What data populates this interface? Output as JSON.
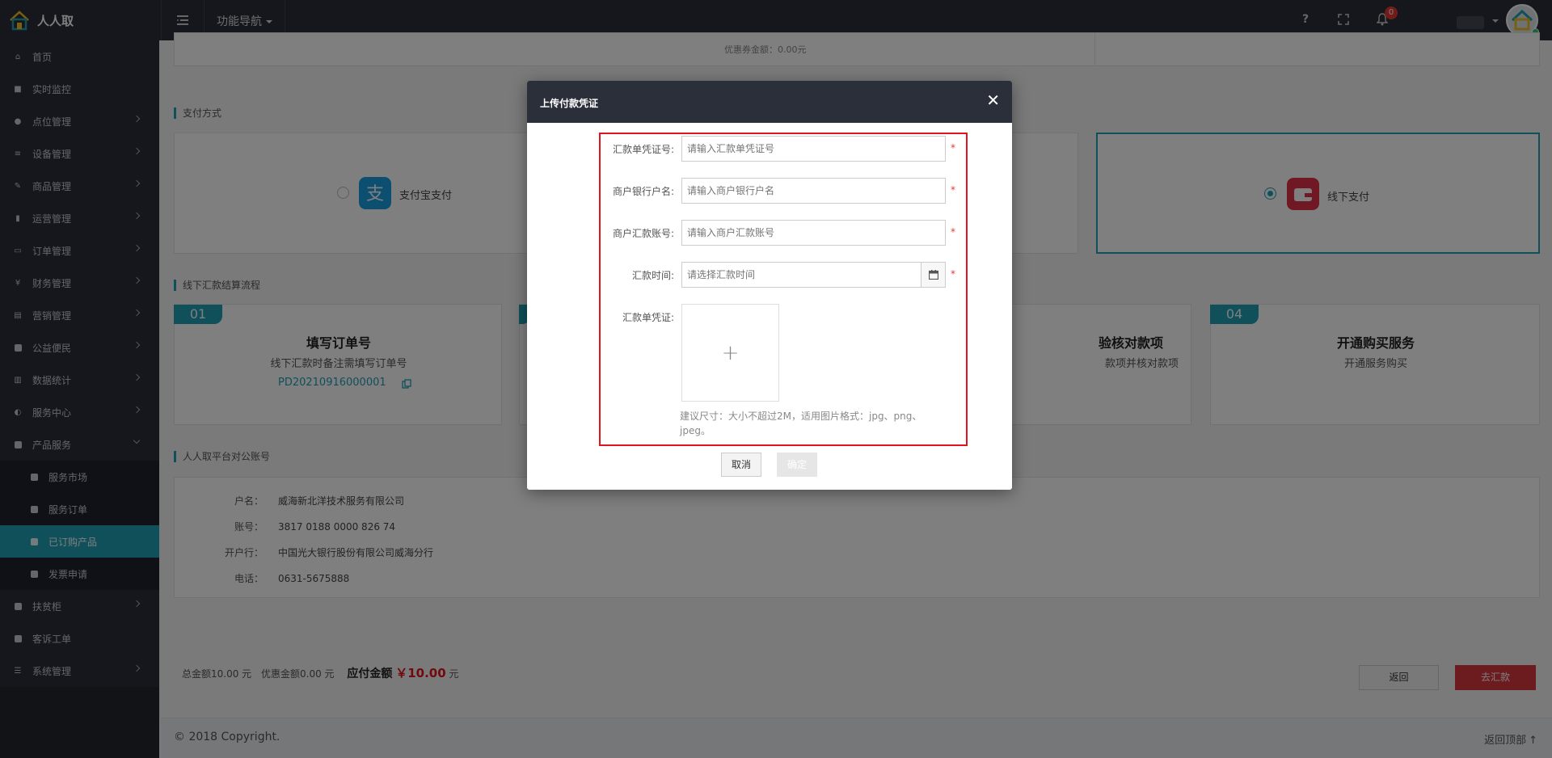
{
  "app": {
    "name": "人人取"
  },
  "topbar": {
    "nav_label": "功能导航",
    "help": "?",
    "notification_count": "0"
  },
  "sidebar": {
    "items": [
      {
        "label": "首页"
      },
      {
        "label": "实时监控"
      },
      {
        "label": "点位管理"
      },
      {
        "label": "设备管理"
      },
      {
        "label": "商品管理"
      },
      {
        "label": "运营管理"
      },
      {
        "label": "订单管理"
      },
      {
        "label": "财务管理"
      },
      {
        "label": "营销管理"
      },
      {
        "label": "公益便民"
      },
      {
        "label": "数据统计"
      },
      {
        "label": "服务中心"
      },
      {
        "label": "产品服务"
      },
      {
        "label": "服务市场"
      },
      {
        "label": "服务订单"
      },
      {
        "label": "已订购产品"
      },
      {
        "label": "发票申请"
      },
      {
        "label": "扶贫柜"
      },
      {
        "label": "客诉工单"
      },
      {
        "label": "系统管理"
      }
    ]
  },
  "payment": {
    "section_title": "支付方式",
    "alipay_label": "支付宝支付",
    "offline_label": "线下支付",
    "top_partial_text": "优惠券金额：0.00元"
  },
  "flow": {
    "section_title": "线下汇款结算流程",
    "steps": [
      {
        "num": "01",
        "title": "填写订单号",
        "desc": "线下汇款时备注需填写订单号",
        "order_no": "PD20210916000001"
      },
      {
        "num": "04",
        "title": "开通购买服务",
        "desc": "开通服务购买"
      }
    ],
    "step3_partial_title": "验核对款项",
    "step3_partial_desc": "款项并核对款项"
  },
  "account": {
    "section_title": "人人取平台对公账号",
    "rows": [
      {
        "label": "户名：",
        "value": "威海新北洋技术服务有限公司"
      },
      {
        "label": "账号：",
        "value": "3817 0188 0000 826 74"
      },
      {
        "label": "开户行：",
        "value": "中国光大银行股份有限公司威海分行"
      },
      {
        "label": "电话：",
        "value": "0631-5675888"
      }
    ]
  },
  "summary": {
    "total": "总金额10.00 元",
    "discount": "优惠金额0.00 元",
    "payable_label": "应付金额",
    "payable_amount": "￥10.00",
    "payable_unit": "元",
    "back_label": "返回",
    "remit_label": "去汇款"
  },
  "footer": {
    "copyright": "© 2018 Copyright.",
    "back_top": "返回顶部"
  },
  "modal": {
    "title": "上传付款凭证",
    "fields": {
      "voucher_no_label": "汇款单凭证号:",
      "voucher_no_placeholder": "请输入汇款单凭证号",
      "bank_name_label": "商户银行户名:",
      "bank_name_placeholder": "请输入商户银行户名",
      "account_no_label": "商户汇款账号:",
      "account_no_placeholder": "请输入商户汇款账号",
      "time_label": "汇款时间:",
      "time_placeholder": "请选择汇款时间",
      "voucher_image_label": "汇款单凭证:"
    },
    "required_mark": "*",
    "upload_plus": "+",
    "hint": "建议尺寸：大小不超过2M，适用图片格式：jpg、png、jpeg。",
    "cancel_label": "取消",
    "ok_label": "确定"
  },
  "colors": {
    "accent": "#1ea0b4",
    "sidebar_bg": "#2b2f3a",
    "danger": "#e0141e",
    "alipay": "#1a9fe0",
    "offline": "#e0334b"
  }
}
